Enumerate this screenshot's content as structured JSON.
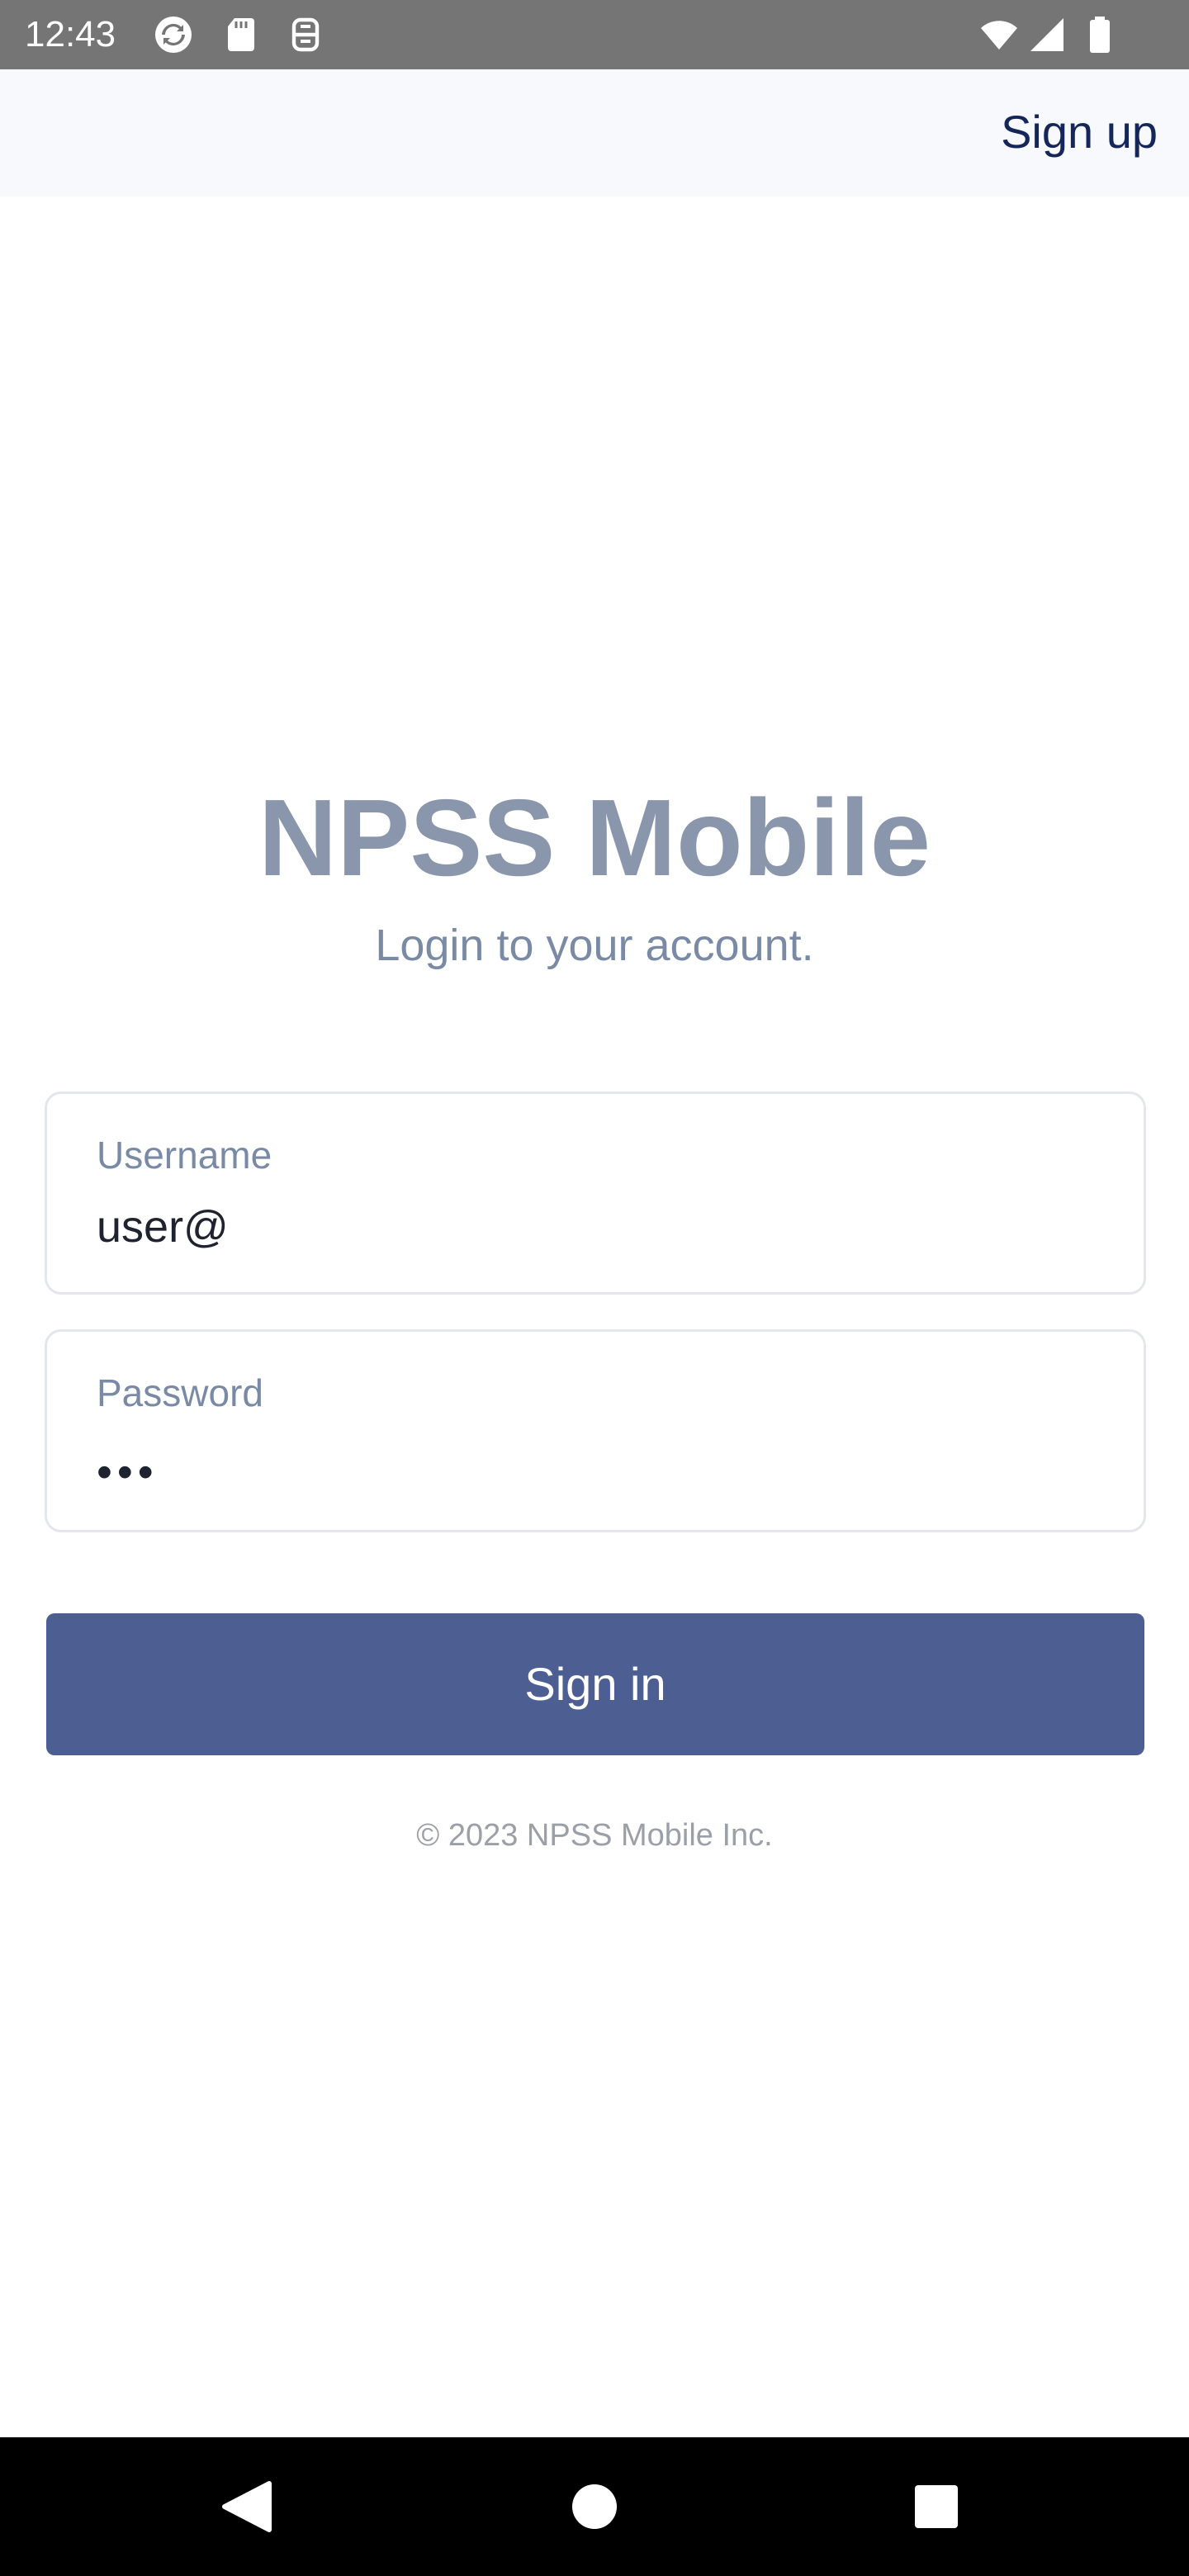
{
  "status_bar": {
    "time": "12:43",
    "icons": [
      "sync-icon",
      "sd-card-icon",
      "accessibility-icon",
      "wifi-icon",
      "cell-signal-icon",
      "battery-icon"
    ]
  },
  "top_bar": {
    "signup_label": "Sign up"
  },
  "main": {
    "title": "NPSS Mobile",
    "subtitle": "Login to your account.",
    "username": {
      "label": "Username",
      "value": "user@"
    },
    "password": {
      "label": "Password",
      "masked_value": "•••"
    },
    "signin_label": "Sign in",
    "copyright": "© 2023 NPSS Mobile Inc."
  },
  "nav_bar": {
    "buttons": [
      "back-icon",
      "home-icon",
      "recents-icon"
    ]
  },
  "colors": {
    "primary": "#4d5f92",
    "title": "#8a96ab",
    "link": "#14265a",
    "status_bar": "#757575"
  }
}
